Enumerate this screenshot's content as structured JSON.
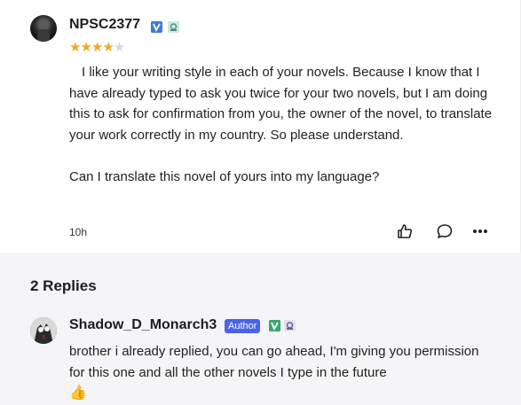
{
  "comment": {
    "username": "NPSC2377",
    "rating": 4,
    "rating_max": 5,
    "paragraph1": "I like your writing style in each of your novels. Because I know that I have already typed to ask you twice for your two novels, but I am doing this to ask for confirmation from you, the owner of the novel, to translate your work correctly in my country. So please understand.",
    "paragraph2": "Can I translate this novel of yours into my language?",
    "time": "10h"
  },
  "replies": {
    "title": "2 Replies",
    "first": {
      "username": "Shadow_D_Monarch3",
      "author_tag": "Author",
      "text": "brother i already replied, you can go ahead, I'm giving you permission for this one and all the other novels I type in the future",
      "emoji": "👍"
    }
  },
  "colors": {
    "star": "#f5a623",
    "author_tag": "#4a63e8",
    "replies_bg": "#f5f5f7"
  }
}
